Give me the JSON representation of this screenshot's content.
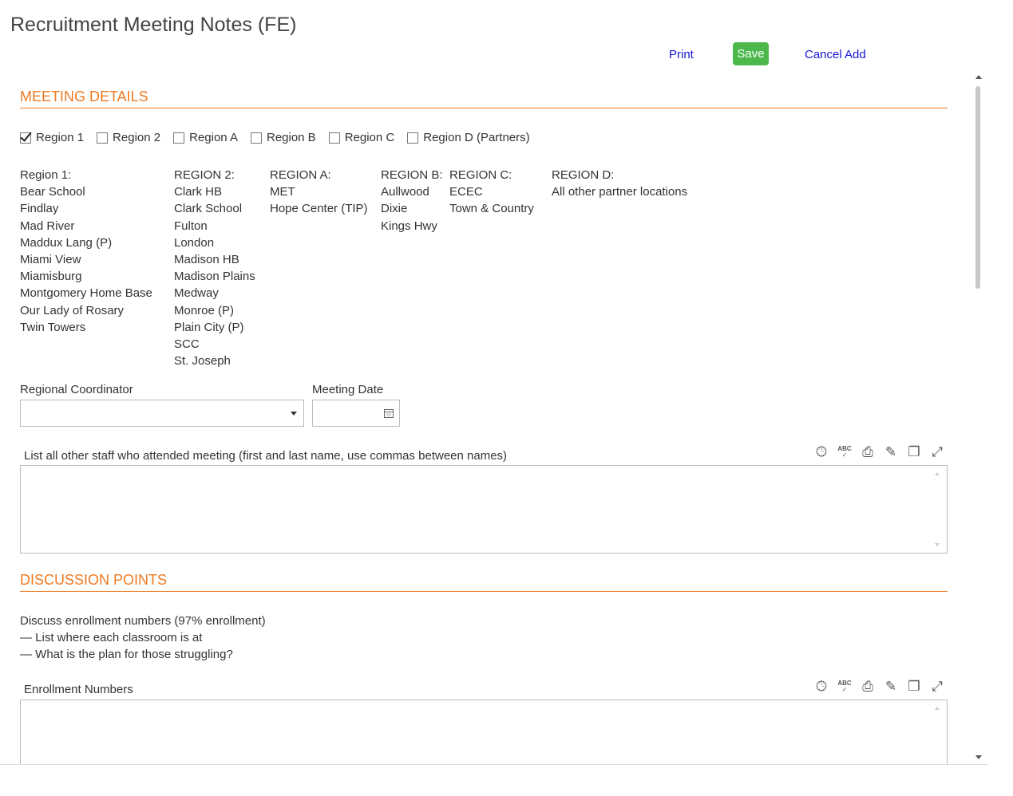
{
  "header": {
    "title": "Recruitment Meeting Notes (FE)",
    "print_label": "Print",
    "save_label": "Save",
    "cancel_label": "Cancel Add"
  },
  "sections": {
    "meeting_details": "MEETING DETAILS",
    "discussion_points": "DISCUSSION POINTS"
  },
  "region_checkboxes": [
    {
      "label": "Region 1",
      "checked": true
    },
    {
      "label": "Region 2",
      "checked": false
    },
    {
      "label": "Region A",
      "checked": false
    },
    {
      "label": "Region B",
      "checked": false
    },
    {
      "label": "Region C",
      "checked": false
    },
    {
      "label": "Region D (Partners)",
      "checked": false
    }
  ],
  "region_lists": [
    {
      "heading": "Region 1:",
      "items": [
        "Bear School",
        "Findlay",
        "Mad River",
        "Maddux Lang (P)",
        "Miami View",
        "Miamisburg",
        "Montgomery Home Base",
        "Our Lady of Rosary",
        "Twin Towers"
      ]
    },
    {
      "heading": "REGION 2:",
      "items": [
        "Clark HB",
        "Clark School",
        "Fulton",
        "London",
        "Madison HB",
        "Madison Plains",
        "Medway",
        "Monroe (P)",
        "Plain City (P)",
        "SCC",
        "St. Joseph"
      ]
    },
    {
      "heading": "REGION A:",
      "items": [
        "MET",
        "Hope Center (TIP)"
      ]
    },
    {
      "heading": "REGION B:",
      "items": [
        "Aullwood",
        "Dixie",
        "Kings Hwy"
      ]
    },
    {
      "heading": "REGION C:",
      "items": [
        "ECEC",
        "Town & Country"
      ]
    },
    {
      "heading": "REGION D:",
      "items": [
        "All other partner locations"
      ]
    }
  ],
  "fields": {
    "coordinator_label": "Regional Coordinator",
    "coordinator_value": "",
    "meeting_date_label": "Meeting Date",
    "meeting_date_value": "",
    "staff_label": "List all other staff who attended meeting (first and last name, use commas between names)",
    "staff_value": "",
    "enrollment_label": "Enrollment Numbers",
    "enrollment_value": ""
  },
  "discussion": {
    "line1": "Discuss enrollment numbers (97% enrollment)",
    "line2": " — List where each classroom is at",
    "line3": " — What is the plan for those struggling?"
  },
  "toolbar_icons": [
    "clock-icon",
    "spellcheck-icon",
    "print-icon",
    "edit-icon",
    "copy-icon",
    "expand-icon"
  ],
  "colors": {
    "accent": "#ee7a22",
    "save": "#4cb84c",
    "link": "#1515d8"
  }
}
